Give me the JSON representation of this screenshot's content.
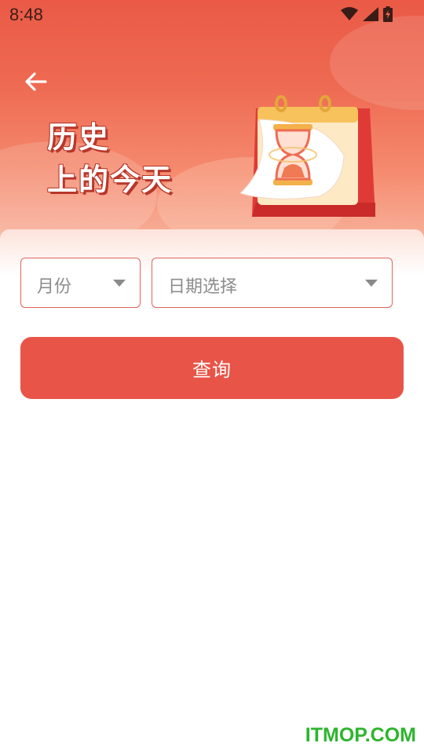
{
  "status_bar": {
    "time": "8:48"
  },
  "header": {
    "title_line1": "历史",
    "title_line2": "上的今天"
  },
  "form": {
    "month_select": {
      "label": "月份"
    },
    "date_select": {
      "label": "日期选择"
    },
    "query_button": {
      "label": "查询"
    }
  },
  "watermark": "ITMOP.COM",
  "colors": {
    "accent": "#e95448",
    "header_top": "#ea5a46",
    "select_border": "#e0655a",
    "watermark": "#2db52d"
  },
  "icons": {
    "back": "arrow-left-icon",
    "wifi": "wifi-icon",
    "signal": "signal-icon",
    "battery": "battery-charging-icon",
    "dropdown": "caret-down-icon",
    "illustration": "calendar-hourglass-illustration"
  }
}
